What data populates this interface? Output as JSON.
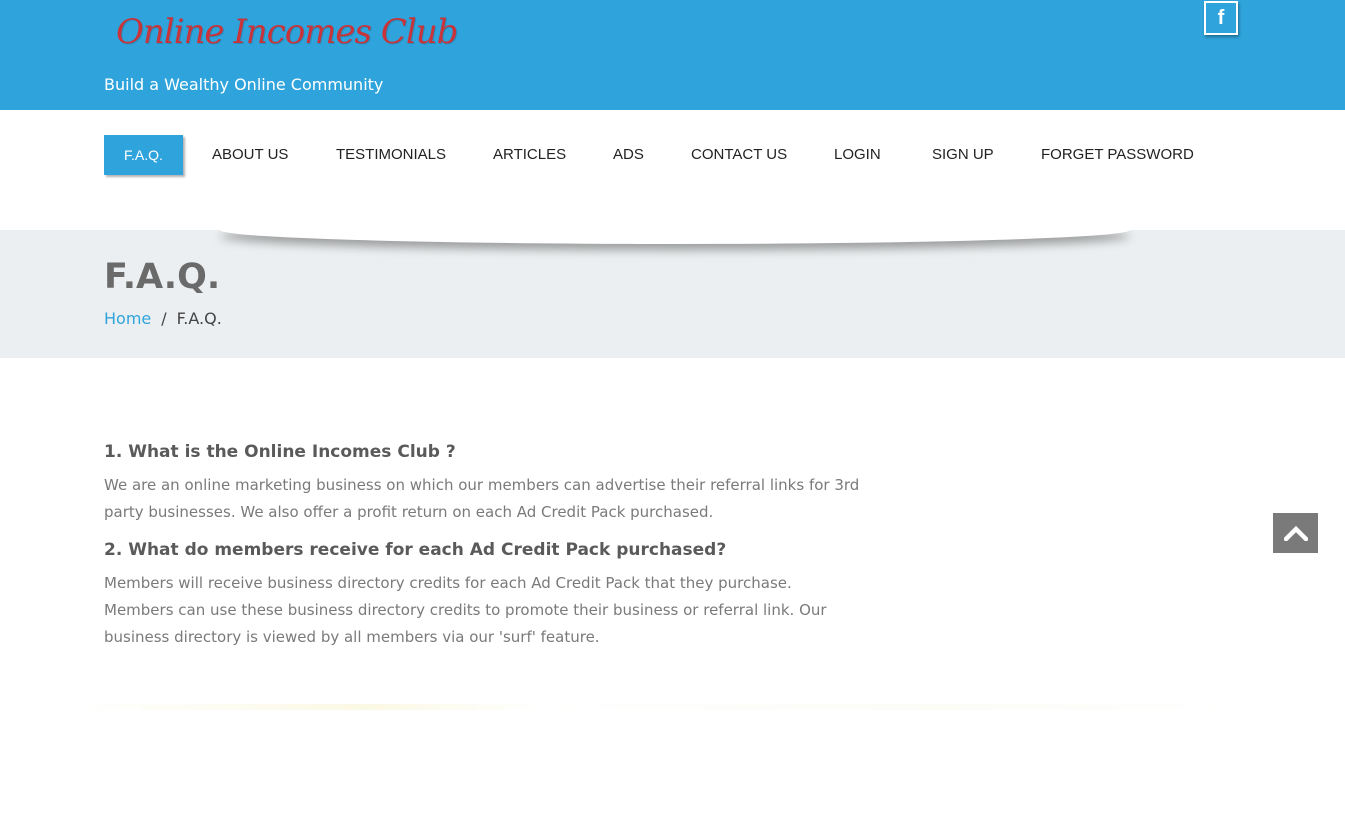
{
  "header": {
    "logo_text": "Online Incomes Club",
    "tagline": "Build a Wealthy Online Community",
    "social_icon": "facebook-icon",
    "brand_color": "#2fa4dc",
    "logo_color": "#c8343a"
  },
  "nav": {
    "items": [
      {
        "label": "F.A.Q.",
        "active": true
      },
      {
        "label": "ABOUT US"
      },
      {
        "label": "TESTIMONIALS"
      },
      {
        "label": "ARTICLES"
      },
      {
        "label": "ADS"
      },
      {
        "label": "CONTACT US"
      },
      {
        "label": "LOGIN"
      },
      {
        "label": "SIGN UP"
      },
      {
        "label": "FORGET PASSWORD"
      }
    ]
  },
  "title_bar": {
    "title": "F.A.Q.",
    "breadcrumb": {
      "home": "Home",
      "separator": "/",
      "current": "F.A.Q."
    }
  },
  "faq": [
    {
      "question": "1. What is the Online Incomes Club ?",
      "answer": "We are an online marketing business on which our members can advertise their referral links for 3rd party businesses. We also offer a profit return on each Ad Credit Pack purchased."
    },
    {
      "question": "2. What do members receive for each Ad Credit Pack purchased?",
      "answer": "Members will receive business directory credits for each Ad Credit Pack that they purchase. Members can use these business directory credits to promote their business or referral link. Our business directory is viewed by all members via our 'surf' feature."
    }
  ],
  "back_to_top": {
    "icon": "chevron-up-icon"
  }
}
